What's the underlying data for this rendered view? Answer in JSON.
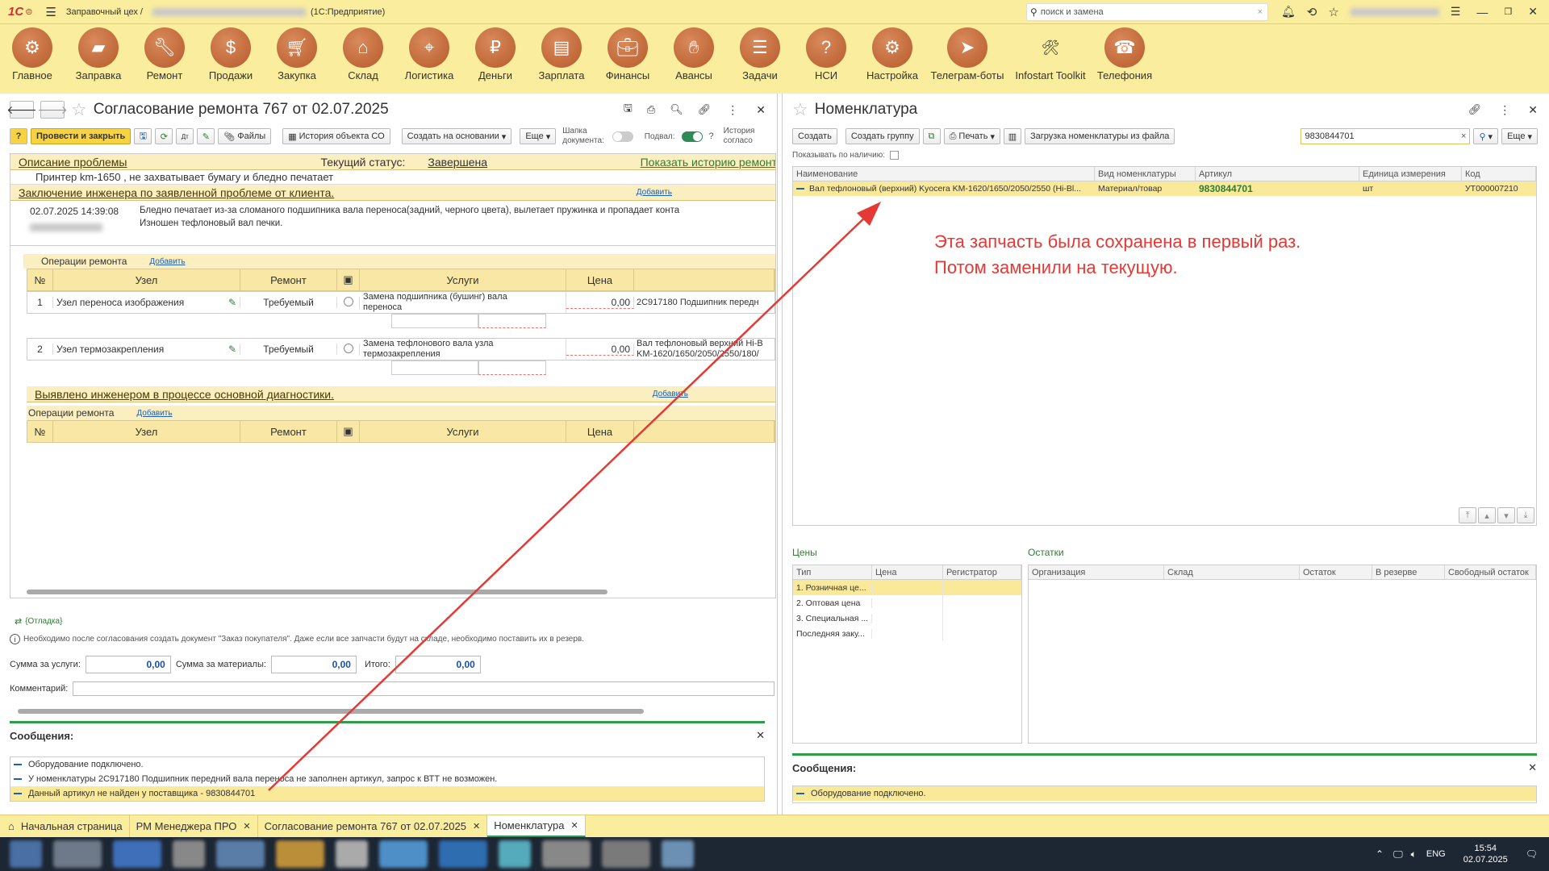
{
  "titlebar": {
    "logo": "1С",
    "app_name": "Заправочный цех /",
    "platform": "(1С:Предприятие)",
    "search_placeholder": "поиск и замена"
  },
  "sections": [
    {
      "label": "Главное",
      "icon": "gear-icon"
    },
    {
      "label": "Заправка",
      "icon": "cartridge-icon"
    },
    {
      "label": "Ремонт",
      "icon": "wrench-icon"
    },
    {
      "label": "Продажи",
      "icon": "sale-icon"
    },
    {
      "label": "Закупка",
      "icon": "cart-icon"
    },
    {
      "label": "Склад",
      "icon": "warehouse-icon"
    },
    {
      "label": "Логистика",
      "icon": "map-icon"
    },
    {
      "label": "Деньги",
      "icon": "money-bag-icon"
    },
    {
      "label": "Зарплата",
      "icon": "wallet-icon"
    },
    {
      "label": "Финансы",
      "icon": "briefcase-icon"
    },
    {
      "label": "Авансы",
      "icon": "hand-coin-icon"
    },
    {
      "label": "Задачи",
      "icon": "tasks-icon"
    },
    {
      "label": "НСИ",
      "icon": "help-book-icon"
    },
    {
      "label": "Настройка",
      "icon": "settings-icon"
    },
    {
      "label": "Телеграм-боты",
      "icon": "telegram-icon"
    },
    {
      "label": "Infostart Toolkit",
      "icon": "tools-icon"
    },
    {
      "label": "Телефония",
      "icon": "phone-icon"
    }
  ],
  "left": {
    "title": "Согласование ремонта 767 от 02.07.2025",
    "toolbar": {
      "post_close": "Провести и закрыть",
      "files": "Файлы",
      "history": "История объекта СО",
      "create_based": "Создать на основании",
      "more": "Еще",
      "header_doc_1": "Шапка",
      "header_doc_2": "документа:",
      "footer": "Подвал:",
      "history_short_1": "История",
      "history_short_2": "согласо"
    },
    "problem": {
      "title": "Описание проблемы",
      "status_label": "Текущий статус:",
      "status_value": "Завершена",
      "show_history": "Показать историю ремонт",
      "text": "Принтер km-1650 , не захватывает бумагу и бледно печатает"
    },
    "conclusion": {
      "title": "Заключение инженера по заявленной проблеме от клиента.",
      "add": "Добавить",
      "datetime": "02.07.2025 14:39:08",
      "text1": "Бледно печатает из-за сломаного подшипника вала переноса(задний, черного цвета), вылетает пружинка и пропадает конта",
      "text2": "Изношен тефлоновый вал печки."
    },
    "ops1": {
      "title": "Операции ремонта",
      "add": "Добавить",
      "cols": {
        "n": "№",
        "node": "Узел",
        "repair": "Ремонт",
        "services": "Услуги",
        "price": "Цена"
      },
      "rows": [
        {
          "n": "1",
          "node": "Узел переноса изображения",
          "repair": "Требуемый",
          "service1": "Замена подшипника (бушинг) вала",
          "service2": "переноса",
          "price": "0,00",
          "part1": "2С917180 Подшипник передн",
          "part2": ""
        },
        {
          "n": "2",
          "node": "Узел термозакрепления",
          "repair": "Требуемый",
          "service1": "Замена тефлонового вала узла",
          "service2": "термозакрепления",
          "price": "0,00",
          "part1": "Вал тефлоновый верхний Hi-B",
          "part2": "KM-1620/1650/2050/2550/180/"
        }
      ]
    },
    "diag": {
      "title": "Выявлено инженером в процессе основной диагностики.",
      "add": "Добавить"
    },
    "ops2": {
      "title": "Операции ремонта",
      "add": "Добавить",
      "cols": {
        "n": "№",
        "node": "Узел",
        "repair": "Ремонт",
        "services": "Услуги",
        "price": "Цена"
      }
    },
    "debug": "{Отладка}",
    "notice": "Необходимо после согласования создать документ \"Заказ покупателя\". Даже если все запчасти будут на складе, необходимо поставить их в резерв.",
    "totals": {
      "services_label": "Сумма за услуги:",
      "services": "0,00",
      "materials_label": "Сумма за материалы:",
      "materials": "0,00",
      "total_label": "Итого:",
      "total": "0,00"
    },
    "comment_label": "Комментарий:",
    "messages": {
      "title": "Сообщения:",
      "items": [
        "Оборудование подключено.",
        "У номенклатуры 2С917180 Подшипник передний вала переноса не заполнен артикул, запрос к ВТТ не возможен.",
        "Данный артикул не найден у поставщика - 9830844701"
      ]
    }
  },
  "right": {
    "title": "Номенклатура",
    "toolbar": {
      "create": "Создать",
      "create_group": "Создать группу",
      "print": "Печать",
      "load": "Загрузка номенклатуры из файла",
      "search_value": "9830844701",
      "more": "Еще"
    },
    "show_available": "Показывать по наличию:",
    "cols": {
      "name": "Наименование",
      "type": "Вид номенклатуры",
      "article": "Артикул",
      "unit": "Единица измерения",
      "code": "Код"
    },
    "row": {
      "name": "Вал тефлоновый (верхний) Kyocera KM-1620/1650/2050/2550 (Hi-Bl...",
      "type": "Материал/товар",
      "article": "9830844701",
      "unit": "шт",
      "code": "УТ000007210"
    },
    "annotation": {
      "line1": "Эта запчасть была сохранена в первый раз.",
      "line2": "Потом заменили на текущую.",
      "color": "#e53935"
    },
    "prices": {
      "title": "Цены",
      "cols": {
        "type": "Тип",
        "price": "Цена",
        "registrar": "Регистратор"
      },
      "rows": [
        "1. Розничная це...",
        "2. Оптовая цена",
        "3. Специальная ...",
        "Последняя заку..."
      ]
    },
    "stock": {
      "title": "Остатки",
      "cols": {
        "org": "Организация",
        "warehouse": "Склад",
        "balance": "Остаток",
        "reserved": "В резерве",
        "free": "Свободный остаток"
      }
    },
    "messages": {
      "title": "Сообщения:",
      "items": [
        "Оборудование подключено."
      ]
    }
  },
  "tabs": [
    {
      "label": "Начальная страница"
    },
    {
      "label": "РМ Менеджера ПРО"
    },
    {
      "label": "Согласование ремонта 767 от 02.07.2025"
    },
    {
      "label": "Номенклатура"
    }
  ],
  "taskbar": {
    "lang": "ENG",
    "time": "15:54",
    "date": "02.07.2025"
  }
}
